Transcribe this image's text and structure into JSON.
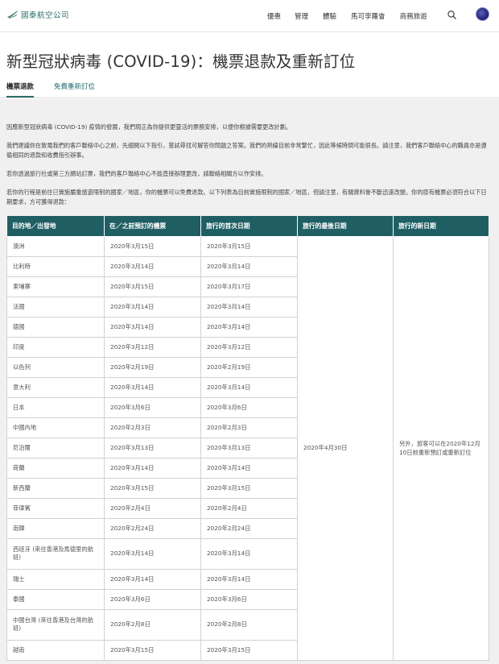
{
  "header": {
    "logo_text": "國泰航空公司",
    "nav": [
      "優惠",
      "管理",
      "體驗",
      "馬可孛羅會",
      "商務旅遊"
    ]
  },
  "page_title": "新型冠狀病毒 (COVID-19)：機票退款及重新訂位",
  "tabs": {
    "active": "機票退款",
    "other": "免費重新訂位"
  },
  "paragraphs": [
    "因應新型冠狀病毒 (COVID-19) 疫情的發展，我們現正為你提供更靈活的票務安排，以便你根據需要更改計劃。",
    "我們建議你在致電我們的客戶聯絡中心之前，先細閱以下指引，嘗試尋找可解答你問題之答案。我們的熱線目前非常繁忙，因此等候時間可能很長。請注意，我們客戶聯絡中心的職員亦是遵循相同的退款和收費指引辦事。",
    "若你透過旅行社或第三方網站訂票，我們的客戶聯絡中心不能直接辦理更改，請聯絡相關方以作安排。",
    "若你的行程是前往已實施嚴重旅遊限制的國家／地區，你的機票可以免費退款。以下列表為目前實施限制的國家／地區，但請注意，有關資料會不斷迅速改變。你的原有機票必須符合以下日期要求，方可獲得退款："
  ],
  "table": {
    "headers": [
      "目的地／出發地",
      "在／之前預訂的機票",
      "旅行的首次日期",
      "旅行的最後日期",
      "旅行的新日期"
    ],
    "rows": [
      [
        "澳洲",
        "2020年3月15日",
        "2020年3月15日"
      ],
      [
        "比利時",
        "2020年3月14日",
        "2020年3月14日"
      ],
      [
        "柬埔寨",
        "2020年3月15日",
        "2020年3月17日"
      ],
      [
        "法國",
        "2020年3月14日",
        "2020年3月14日"
      ],
      [
        "德國",
        "2020年3月14日",
        "2020年3月14日"
      ],
      [
        "印度",
        "2020年3月12日",
        "2020年3月12日"
      ],
      [
        "以色列",
        "2020年2月19日",
        "2020年2月19日"
      ],
      [
        "意大利",
        "2020年3月14日",
        "2020年3月14日"
      ],
      [
        "日本",
        "2020年3月6日",
        "2020年3月6日"
      ],
      [
        "中國內地",
        "2020年2月3日",
        "2020年2月3日"
      ],
      [
        "尼泊爾",
        "2020年3月13日",
        "2020年3月13日"
      ],
      [
        "荷蘭",
        "2020年3月14日",
        "2020年3月14日"
      ],
      [
        "新西蘭",
        "2020年3月15日",
        "2020年3月15日"
      ],
      [
        "菲律賓",
        "2020年2月4日",
        "2020年2月4日"
      ],
      [
        "南韓",
        "2020年2月24日",
        "2020年2月24日"
      ],
      [
        "西班牙 (來往香港及馬德里的航班)",
        "2020年3月14日",
        "2020年3月14日"
      ],
      [
        "瑞士",
        "2020年3月14日",
        "2020年3月14日"
      ],
      [
        "泰國",
        "2020年3月6日",
        "2020年3月6日"
      ],
      [
        "中國台灣 (來往香港及台灣的航班)",
        "2020年2月8日",
        "2020年2月8日"
      ],
      [
        "越南",
        "2020年3月15日",
        "2020年3月15日"
      ]
    ],
    "last_date": "2020年4月30日",
    "new_date": "另外，旅客可以在2020年12月10日前重新預訂或重新訂位"
  },
  "colors": {
    "brand": "#2f6d6a",
    "table_header": "#1f5f64",
    "content_bg": "#f0f0f0"
  },
  "icons": {
    "search": "search-icon",
    "avatar": "avatar"
  }
}
